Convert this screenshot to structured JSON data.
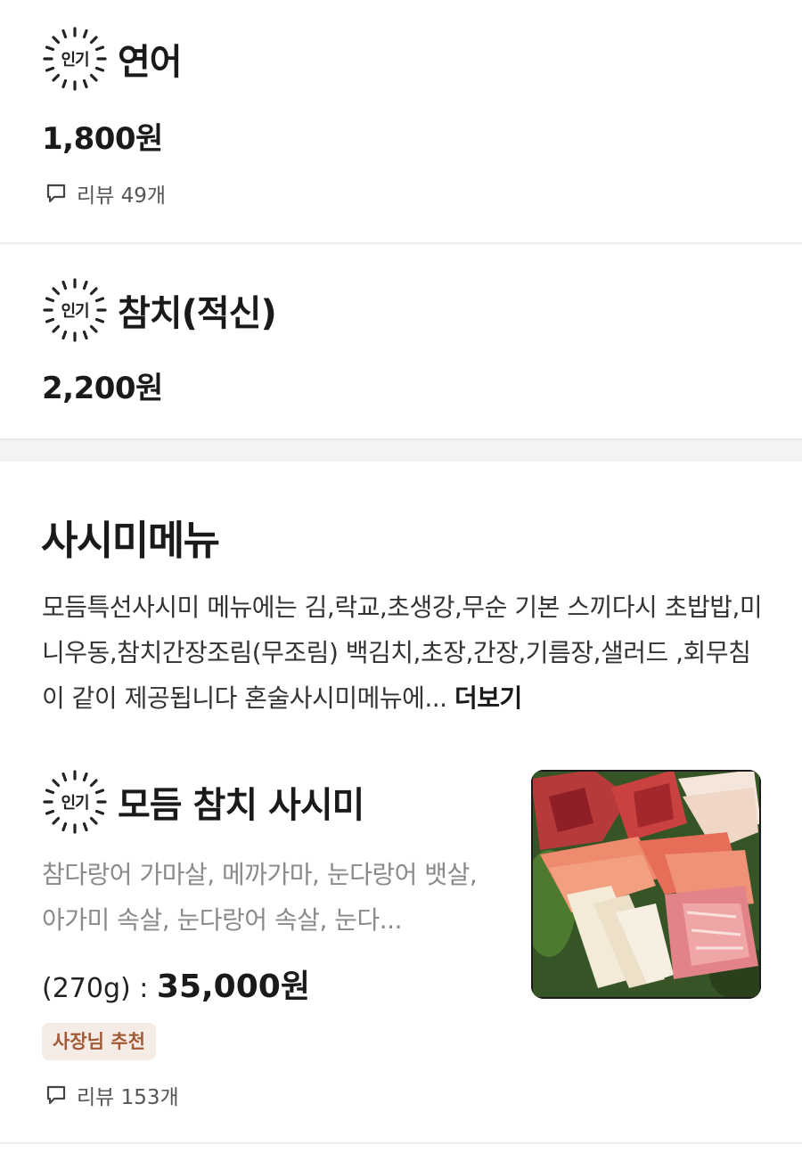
{
  "items_top": [
    {
      "badge": "인기",
      "name": "연어",
      "price": "1,800원",
      "review": "리뷰 49개"
    },
    {
      "badge": "인기",
      "name": "참치(적신)",
      "price": "2,200원"
    }
  ],
  "section": {
    "title": "사시미메뉴",
    "description": "모듬특선사시미 메뉴에는 김,락교,초생강,무순 기본 스끼다시 초밥밥,미니우동,참치간장조림(무조림) 백김치,초장,간장,기름장,샐러드 ,회무침이 같이 제공됩니다 혼술사시미메뉴에... ",
    "more_label": "더보기"
  },
  "menu_item": {
    "badge": "인기",
    "name": "모듬 참치 사시미",
    "description": "참다랑어 가마살, 메까가마, 눈다랑어 뱃살, 아가미 속살, 눈다랑어 속살, 눈다...",
    "weight": "(270g) : ",
    "price": "35,000원",
    "tag": "사장님 추천",
    "review": "리뷰 153개",
    "image_icon": "sashimi-photo"
  },
  "colors": {
    "divider": "#eeeeee",
    "section_gap": "#f2f3f5",
    "tag_bg": "#f5ece6",
    "tag_text": "#a35a36",
    "muted_text": "#8a8a8a"
  }
}
